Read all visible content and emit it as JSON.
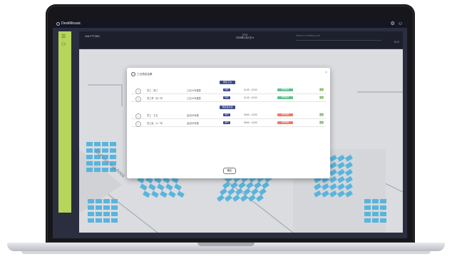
{
  "app": {
    "title": "DeskMosaic",
    "top_icons": [
      "⚙",
      "☺"
    ]
  },
  "header": {
    "floor_label": "Unit FTTCBC",
    "date_top": "2025",
    "date_main": "2025年1月1日 ▾",
    "search_placeholder": "Search a building unit",
    "view_icons": "⊞ ⊟"
  },
  "sidebar": {
    "icons": [
      "☰",
      "⚇"
    ]
  },
  "map": {
    "zone_label": "Outsourcing Area"
  },
  "modal": {
    "title": "工位预定结果",
    "close": "×",
    "sections": [
      {
        "label": "预定工位",
        "rows": [
          {
            "name": "员工 · 张三",
            "desk": "工位A1号楼层",
            "type": "固定",
            "time": "11:00 - 12:00",
            "status": "预约成功",
            "action": "签到"
          },
          {
            "name": "员工李 · 四一号",
            "desk": "工位A1号楼层",
            "type": "固定",
            "time": "11:00 - 12:00",
            "status": "预约成功",
            "action": "签到"
          }
        ]
      },
      {
        "label": "预定会议室",
        "rows": [
          {
            "name": "员工 · 王五",
            "desk": "会议B3号楼",
            "type": "临时",
            "time": "09:00 - 10:00",
            "status": "预约失败",
            "action": "签到"
          },
          {
            "name": "员工赵 · 六一号",
            "desk": "会议B3号楼",
            "type": "临时",
            "time": "09:00 - 10:00",
            "status": "预约失败",
            "action": "签到"
          }
        ]
      }
    ],
    "confirm_label": "确定",
    "colors": {
      "success": "#5cc18f",
      "fail": "#e97a6e",
      "type_pill": "#3c4a8a",
      "desk_tile": "#5ab4dc",
      "sidebar": "#b6d55b"
    }
  }
}
